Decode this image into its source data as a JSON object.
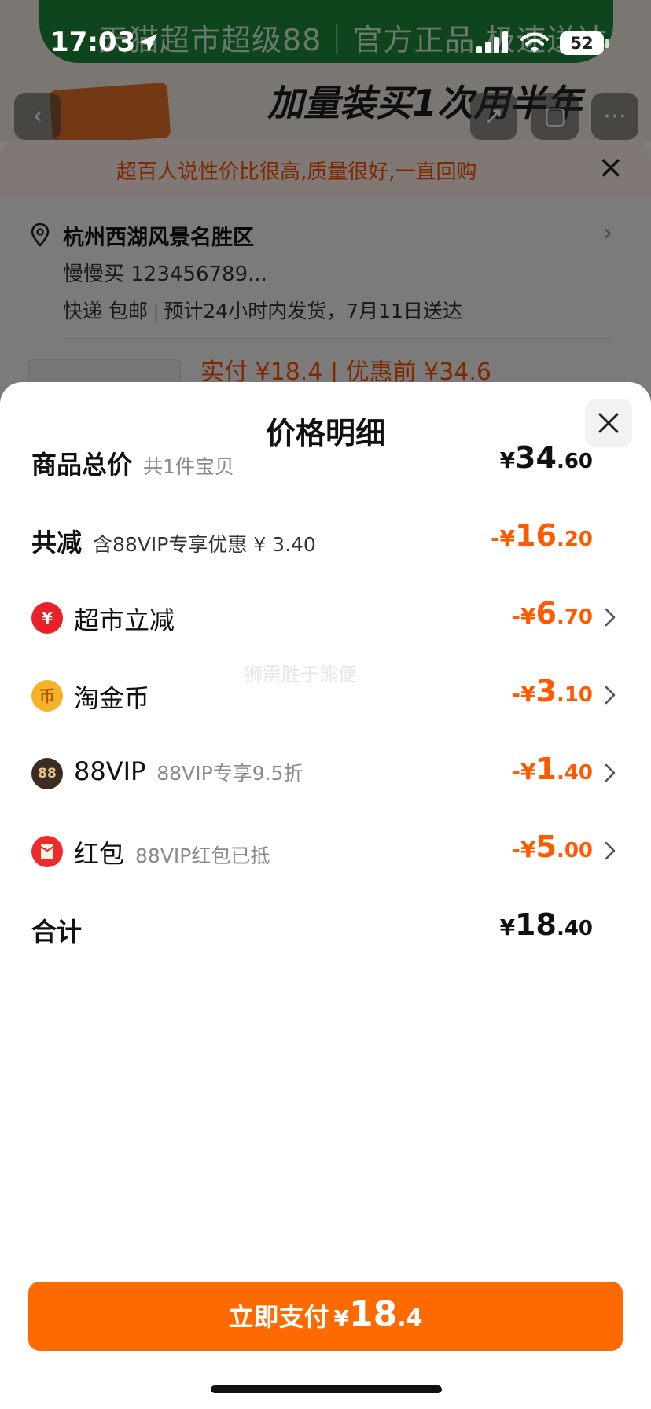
{
  "status_bar": {
    "time": "17:03",
    "battery": "52"
  },
  "background": {
    "banner_text": "天猫超市超级88｜官方正品 极速送达",
    "slogan": "加量装买1次用半年",
    "tip": "超百人说性价比很高,质量很好,一直回购",
    "address": "杭州西湖风景名胜区",
    "recipient": "慢慢买 123456789...",
    "shipping_method": "快递 包邮",
    "shipping_estimate": "预计24小时内发货，7月11日送达",
    "pay_preview": "实付 ¥18.4 | 优惠前 ¥34.6"
  },
  "sheet": {
    "title": "价格明细",
    "watermark": "狮雳胜于熊便",
    "rows": [
      {
        "label": "商品总价",
        "sub": "共1件宝贝",
        "cur": "¥",
        "int": "34",
        "dec": ".60"
      },
      {
        "label": "共减",
        "sub": "含88VIP专享优惠 ¥ 3.40",
        "cur": "-¥",
        "int": "16",
        "dec": ".20"
      },
      {
        "label": "超市立减",
        "sub": "",
        "cur": "-¥",
        "int": "6",
        "dec": ".70",
        "icon": "supermarket-discount-icon"
      },
      {
        "label": "淘金币",
        "sub": "",
        "cur": "-¥",
        "int": "3",
        "dec": ".10",
        "icon": "taojinbi-coin-icon"
      },
      {
        "label": "88VIP",
        "sub": "88VIP专享9.5折",
        "cur": "-¥",
        "int": "1",
        "dec": ".40",
        "icon": "88vip-badge-icon",
        "icon_text": "88"
      },
      {
        "label": "红包",
        "sub": "88VIP红包已抵",
        "cur": "-¥",
        "int": "5",
        "dec": ".00",
        "icon": "red-envelope-icon"
      },
      {
        "label": "合计",
        "sub": "",
        "cur": "¥",
        "int": "18",
        "dec": ".40"
      }
    ],
    "pay_button": {
      "label": "立即支付",
      "cur": "¥",
      "int": "18",
      "dec": ".4"
    }
  },
  "colors": {
    "accent": "#ff6a00",
    "discount": "#ff5a00",
    "text": "#111111"
  }
}
